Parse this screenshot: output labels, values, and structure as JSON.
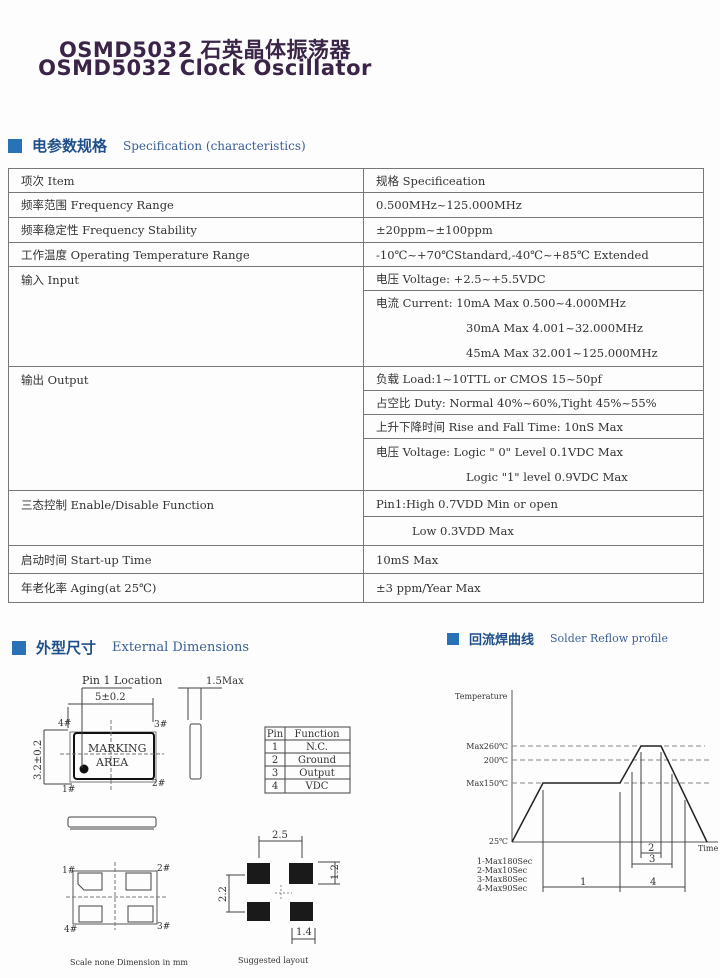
{
  "header": {
    "title_cn": "OSMD5032 石英晶体振荡器",
    "title_en": "OSMD5032 Clock Oscillator"
  },
  "spec_section": {
    "title_cn": "电参数规格",
    "title_en": "Specification (characteristics)",
    "color": "#2a72b8"
  },
  "spec_table": {
    "header": {
      "item": "项次 Item",
      "spec": "规格  Specificeation"
    },
    "freq_range": {
      "item": "频率范围  Frequency Range",
      "spec": "0.500MHz~125.000MHz"
    },
    "freq_stability": {
      "item": "频率稳定性  Frequency Stability",
      "spec": "±20ppm~±100ppm"
    },
    "op_temp": {
      "item": "工作温度 Operating Temperature Range",
      "spec": "-10℃~+70℃Standard,-40℃~+85℃ Extended"
    },
    "input": {
      "item": "输入  Input",
      "voltage": "电压  Voltage: +2.5~+5.5VDC",
      "current1": "电流  Current: 10mA Max 0.500~4.000MHz",
      "current2": "30mA Max 4.001~32.000MHz",
      "current3": "45mA Max 32.001~125.000MHz"
    },
    "output": {
      "item": "输出   Output",
      "load": "负载   Load:1~10TTL or CMOS 15~50pf",
      "duty": "占空比  Duty: Normal 40%~60%,Tight 45%~55%",
      "rise_fall": "上升下降时间  Rise and Fall Time: 10nS Max",
      "voltage0": "电压 Voltage: Logic \" 0\"  Level 0.1VDC Max",
      "voltage1": "Logic \"1\"  level  0.9VDC Max"
    },
    "enable": {
      "item": "三态控制  Enable/Disable Function",
      "high": "Pin1:High 0.7VDD Min or open",
      "low": "Low 0.3VDD Max"
    },
    "startup": {
      "item": "启动时间   Start-up Time",
      "spec": "10mS Max"
    },
    "aging": {
      "item": "年老化率  Aging(at 25℃)",
      "spec": "±3 ppm/Year Max"
    }
  },
  "dimensions": {
    "title_cn": "外型尺寸",
    "title_en": "External Dimensions",
    "pin1_location": "Pin 1 Location",
    "width": "5±0.2",
    "height": "3.2±0.2",
    "thickness": "1.5Max",
    "marking_1": "MARKING",
    "marking_2": "AREA",
    "pins": {
      "p1": "1#",
      "p2": "2#",
      "p3": "3#",
      "p4": "4#"
    },
    "pin_table": {
      "headers": [
        "Pin",
        "Function"
      ],
      "rows": [
        [
          "1",
          "N.C."
        ],
        [
          "2",
          "Ground"
        ],
        [
          "3",
          "Output"
        ],
        [
          "4",
          "VDC"
        ]
      ]
    },
    "layout_pitch_x": "2.5",
    "layout_pad_h": "1.2",
    "layout_pitch_y": "2.2",
    "layout_pad_w": "1.4",
    "caption_left": "Scale none Dimension in mm",
    "caption_right": "Suggested layout"
  },
  "reflow": {
    "title_cn": "回流焊曲线",
    "title_en": "Solder Reflow profile",
    "y_label": "Temperature",
    "x_label": "Time",
    "levels": [
      "Max260℃",
      "200℃",
      "Max150℃",
      "25℃"
    ],
    "zones": [
      "1",
      "2",
      "3",
      "4"
    ],
    "legend": [
      "1-Max180Sec",
      "2-Max10Sec",
      "3-Max80Sec",
      "4-Max90Sec"
    ]
  }
}
